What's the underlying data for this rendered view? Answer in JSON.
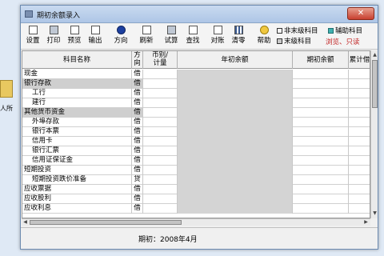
{
  "window": {
    "title": "期初余额录入",
    "close_glyph": "✕"
  },
  "desktop": {
    "icon_label": "人所"
  },
  "toolbar": {
    "buttons": [
      {
        "label": "设置",
        "icon": "settings-icon"
      },
      {
        "label": "打印",
        "icon": "print-icon"
      },
      {
        "label": "预览",
        "icon": "preview-icon"
      },
      {
        "label": "输出",
        "icon": "export-icon"
      },
      {
        "label": "方向",
        "icon": "direction-icon"
      },
      {
        "label": "刷新",
        "icon": "refresh-icon"
      },
      {
        "label": "试算",
        "icon": "trial-balance-icon"
      },
      {
        "label": "查找",
        "icon": "find-icon"
      },
      {
        "label": "对账",
        "icon": "reconcile-icon"
      },
      {
        "label": "清零",
        "icon": "clear-icon"
      },
      {
        "label": "帮助",
        "icon": "help-icon"
      }
    ],
    "legend": {
      "non_leaf": "非末级科目",
      "auxiliary": "辅助科目",
      "leaf": "末级科目",
      "readonly_note": "浏览、只读"
    }
  },
  "table": {
    "headers": {
      "name": "科目名称",
      "direction_line1": "方",
      "direction_line2": "向",
      "currency_line1": "币别/",
      "currency_line2": "计量",
      "year_begin": "年初余额",
      "initial": "期初余额",
      "cumulative": "累计借"
    },
    "rows": [
      {
        "name": "现金",
        "dir": "借",
        "style": "leaf"
      },
      {
        "name": "银行存款",
        "dir": "借",
        "style": "nonleaf"
      },
      {
        "name": "工行",
        "dir": "借",
        "style": "leaf",
        "indent": 1
      },
      {
        "name": "建行",
        "dir": "借",
        "style": "leaf",
        "indent": 1
      },
      {
        "name": "其他货币资金",
        "dir": "借",
        "style": "nonleaf"
      },
      {
        "name": "外埠存款",
        "dir": "借",
        "style": "leaf",
        "indent": 1
      },
      {
        "name": "银行本票",
        "dir": "借",
        "style": "leaf",
        "indent": 1
      },
      {
        "name": "信用卡",
        "dir": "借",
        "style": "leaf",
        "indent": 1
      },
      {
        "name": "银行汇票",
        "dir": "借",
        "style": "leaf",
        "indent": 1
      },
      {
        "name": "信用证保证金",
        "dir": "借",
        "style": "leaf",
        "indent": 1
      },
      {
        "name": "短期投资",
        "dir": "借",
        "style": "leaf"
      },
      {
        "name": "短期投资跌价准备",
        "dir": "贷",
        "style": "leaf",
        "indent": 1
      },
      {
        "name": "应收票据",
        "dir": "借",
        "style": "leaf"
      },
      {
        "name": "应收股利",
        "dir": "借",
        "style": "leaf"
      },
      {
        "name": "应收利息",
        "dir": "借",
        "style": "leaf"
      }
    ]
  },
  "status": {
    "period": "期初：2008年4月"
  }
}
